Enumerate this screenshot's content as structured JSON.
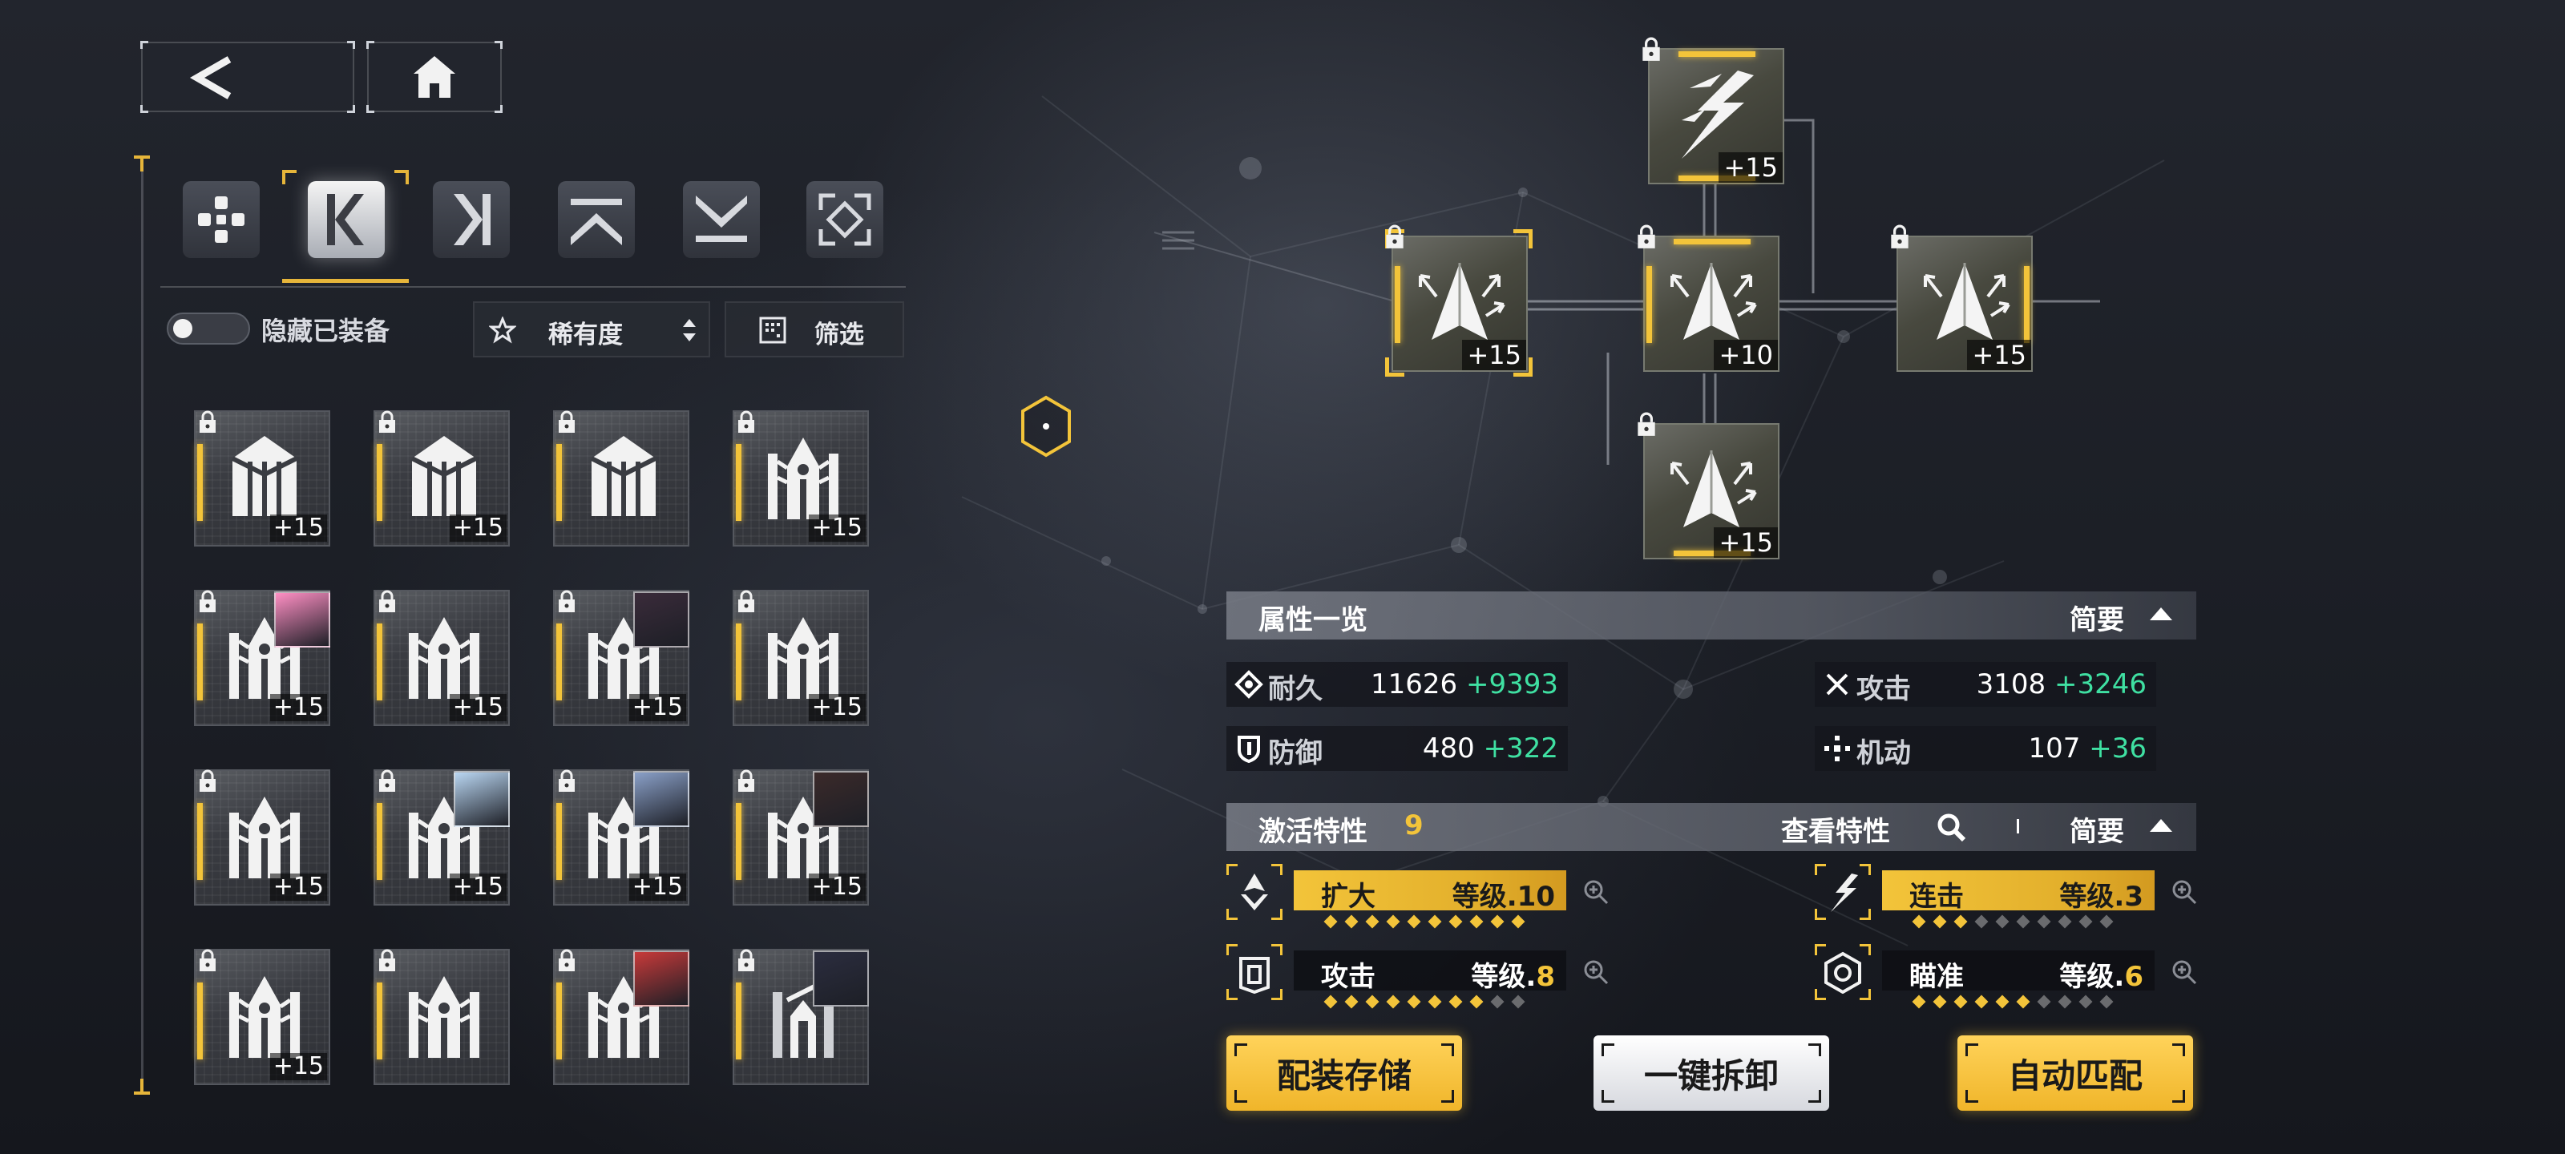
{
  "nav": {
    "back_icon": "chevron-left-icon",
    "home_icon": "home-icon"
  },
  "categories": [
    {
      "icon": "all-parts-icon",
      "selected": false
    },
    {
      "icon": "left-part-icon",
      "selected": true
    },
    {
      "icon": "right-part-icon",
      "selected": false
    },
    {
      "icon": "top-part-icon",
      "selected": false
    },
    {
      "icon": "bottom-part-icon",
      "selected": false
    },
    {
      "icon": "frame-part-icon",
      "selected": false
    }
  ],
  "filters": {
    "hide_equipped_label": "隐藏已装备",
    "hide_equipped_on": false,
    "rarity_label": "稀有度",
    "filter_label": "筛选"
  },
  "inventory": [
    {
      "level": "+15",
      "avatar": false
    },
    {
      "level": "+15",
      "avatar": false
    },
    {
      "level": "",
      "avatar": false
    },
    {
      "level": "+15",
      "avatar": false
    },
    {
      "level": "+15",
      "avatar": true,
      "avatar_color": "#ff8fc4"
    },
    {
      "level": "+15",
      "avatar": false
    },
    {
      "level": "+15",
      "avatar": true,
      "avatar_color": "#3a2b3a"
    },
    {
      "level": "+15",
      "avatar": false
    },
    {
      "level": "+15",
      "avatar": false
    },
    {
      "level": "+15",
      "avatar": true,
      "avatar_color": "#b9d6f2"
    },
    {
      "level": "+15",
      "avatar": true,
      "avatar_color": "#8aa0c8"
    },
    {
      "level": "+15",
      "avatar": true,
      "avatar_color": "#3b2a2a"
    },
    {
      "level": "+15",
      "avatar": false
    },
    {
      "level": "",
      "avatar": false
    },
    {
      "level": "",
      "avatar": true,
      "avatar_color": "#c83a3a"
    },
    {
      "level": "",
      "avatar": true,
      "avatar_color": "#2b2d3f"
    }
  ],
  "equipped": [
    {
      "id": "top",
      "level": "+15"
    },
    {
      "id": "left",
      "level": "+15"
    },
    {
      "id": "center",
      "level": "+10"
    },
    {
      "id": "right",
      "level": "+15"
    },
    {
      "id": "bottom",
      "level": "+15"
    }
  ],
  "attributes": {
    "title": "属性一览",
    "toggle": "简要",
    "stats": [
      {
        "icon": "durability-icon",
        "name": "耐久",
        "value": "11626",
        "bonus": "+9393"
      },
      {
        "icon": "attack-icon",
        "name": "攻击",
        "value": "3108",
        "bonus": "+3246"
      },
      {
        "icon": "defense-icon",
        "name": "防御",
        "value": "480",
        "bonus": "+322"
      },
      {
        "icon": "mobility-icon",
        "name": "机动",
        "value": "107",
        "bonus": "+36"
      }
    ]
  },
  "traits": {
    "title": "激活特性",
    "count": "9",
    "view_label": "查看特性",
    "toggle": "简要",
    "list": [
      {
        "name": "扩大",
        "level_label": "等级.",
        "level": "10",
        "highlight": true,
        "filled": 10
      },
      {
        "name": "连击",
        "level_label": "等级.",
        "level": "3",
        "highlight": true,
        "filled": 3
      },
      {
        "name": "攻击",
        "level_label": "等级.",
        "level": "8",
        "highlight": false,
        "filled": 8
      },
      {
        "name": "瞄准",
        "level_label": "等级.",
        "level": "6",
        "highlight": false,
        "filled": 6
      }
    ]
  },
  "actions": {
    "save": "配装存储",
    "unequip": "一键拆卸",
    "auto": "自动匹配"
  },
  "colors": {
    "accent_gold": "#f3c43a",
    "bonus_green": "#3fe0a2"
  }
}
